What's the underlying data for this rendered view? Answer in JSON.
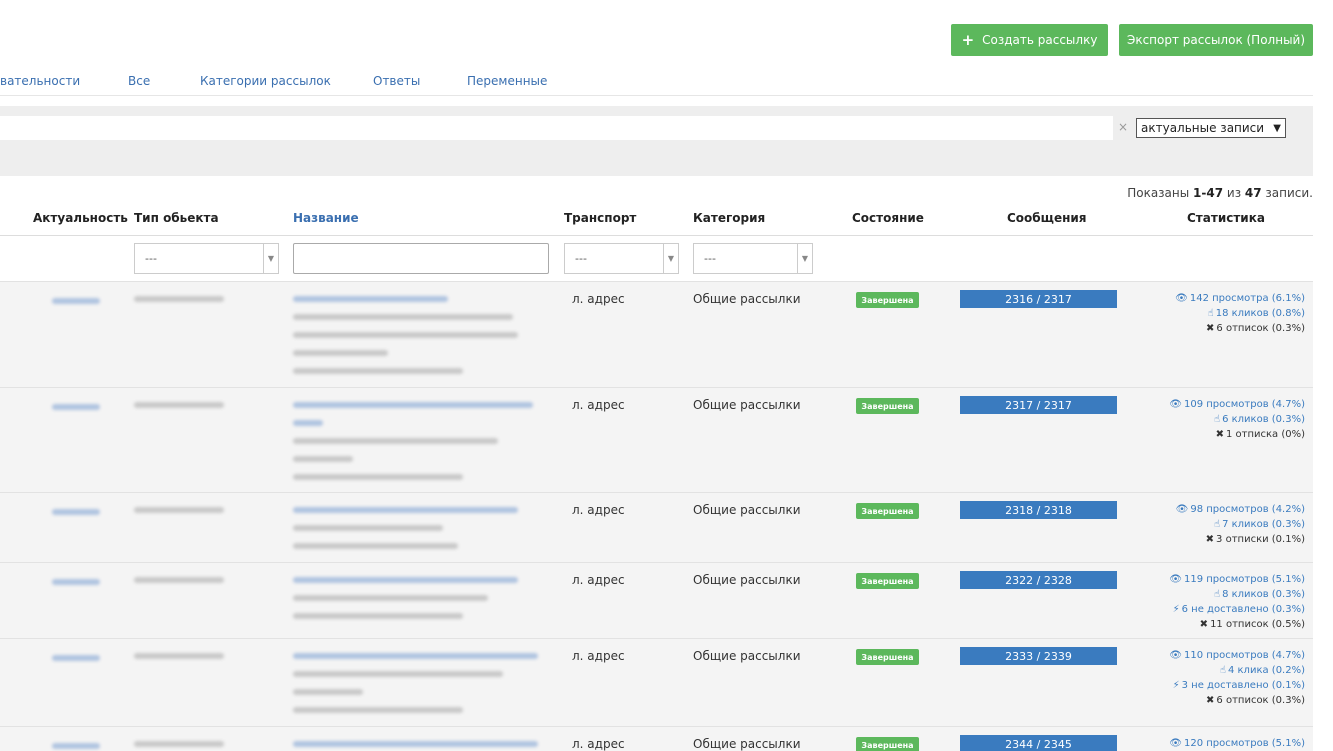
{
  "buttons": {
    "create": "Создать рассылку",
    "export": "Экспорт рассылок (Полный)"
  },
  "tabs": [
    {
      "label": "вательности"
    },
    {
      "label": "Все"
    },
    {
      "label": "Категории рассылок"
    },
    {
      "label": "Ответы"
    },
    {
      "label": "Переменные"
    }
  ],
  "filter": {
    "clear": "×",
    "select_value": "актуальные записи"
  },
  "summary": {
    "prefix": "Показаны ",
    "range": "1-47",
    "middle": " из ",
    "total": "47",
    "suffix": " записи."
  },
  "columns": {
    "relevance": "Актуальность",
    "object_type": "Тип обьекта",
    "name": "Название",
    "transport": "Транспорт",
    "category": "Категория",
    "state": "Состояние",
    "messages": "Сообщения",
    "stats": "Статистика"
  },
  "column_filters": {
    "object_type": "---",
    "transport": "---",
    "category": "---"
  },
  "rows": [
    {
      "transport": "л. адрес",
      "category": "Общие рассылки",
      "status": "Завершена",
      "messages": "2316 / 2317",
      "stats": [
        "142 просмотра (6.1%)",
        "18 кликов (0.8%)",
        "6 отписок (0.3%)"
      ]
    },
    {
      "transport": "л. адрес",
      "category": "Общие рассылки",
      "status": "Завершена",
      "messages": "2317 / 2317",
      "stats": [
        "109 просмотров (4.7%)",
        "6 кликов (0.3%)",
        "1 отписка (0%)"
      ]
    },
    {
      "transport": "л. адрес",
      "category": "Общие рассылки",
      "status": "Завершена",
      "messages": "2318 / 2318",
      "stats": [
        "98 просмотров (4.2%)",
        "7 кликов (0.3%)",
        "3 отписки (0.1%)"
      ]
    },
    {
      "transport": "л. адрес",
      "category": "Общие рассылки",
      "status": "Завершена",
      "messages": "2322 / 2328",
      "stats": [
        "119 просмотров (5.1%)",
        "8 кликов (0.3%)",
        "6 не доставлено (0.3%)",
        "11 отписок (0.5%)"
      ]
    },
    {
      "transport": "л. адрес",
      "category": "Общие рассылки",
      "status": "Завершена",
      "messages": "2333 / 2339",
      "stats": [
        "110 просмотров (4.7%)",
        "4 клика (0.2%)",
        "3 не доставлено (0.1%)",
        "6 отписок (0.3%)"
      ]
    },
    {
      "transport": "л. адрес",
      "category": "Общие рассылки",
      "status": "Завершена",
      "messages": "2344 / 2345",
      "stats": [
        "120 просмотров (5.1%)"
      ]
    }
  ]
}
